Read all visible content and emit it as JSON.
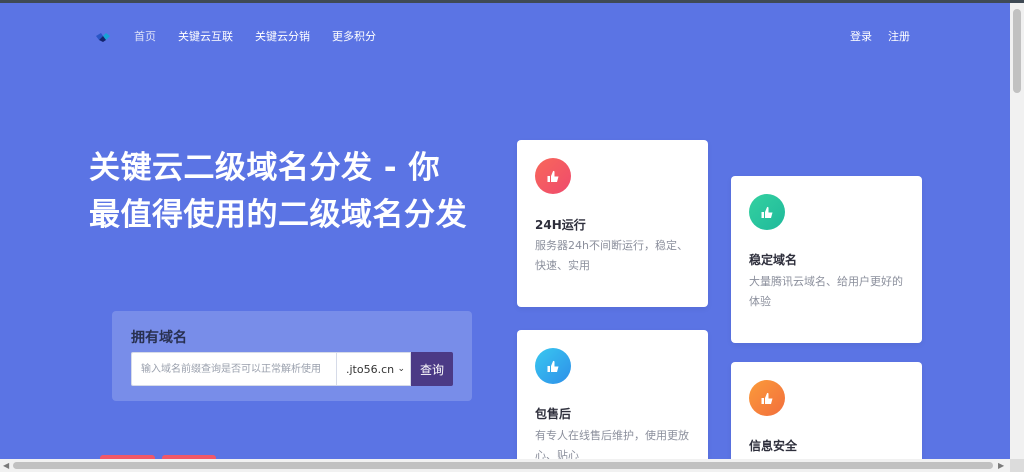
{
  "header": {
    "nav": [
      "首页",
      "关键云互联",
      "关键云分销",
      "更多积分"
    ],
    "login": "登录",
    "register": "注册"
  },
  "hero": {
    "title": "关键云二级域名分发 - 你最值得使用的二级域名分发"
  },
  "domain_box": {
    "label": "拥有域名",
    "input_placeholder": "输入域名前缀查询是否可以正常解析使用",
    "input_value": "",
    "suffix_selected": ".jto56.cn",
    "query_button": "查询"
  },
  "features": [
    {
      "title": "24H运行",
      "desc": "服务器24h不间断运行，稳定、快速、实用",
      "icon": "thumb-up-icon",
      "color": "#f4565f"
    },
    {
      "title": "稳定域名",
      "desc": "大量腾讯云域名、给用户更好的体验",
      "icon": "thumb-up-icon",
      "color": "#26c19d"
    },
    {
      "title": "包售后",
      "desc": "有专人在线售后维护，使用更放心、贴心",
      "icon": "thumb-up-icon",
      "color": "#33aaf0"
    },
    {
      "title": "信息安全",
      "desc": "",
      "icon": "thumb-up-icon",
      "color": "#f7853c"
    }
  ]
}
